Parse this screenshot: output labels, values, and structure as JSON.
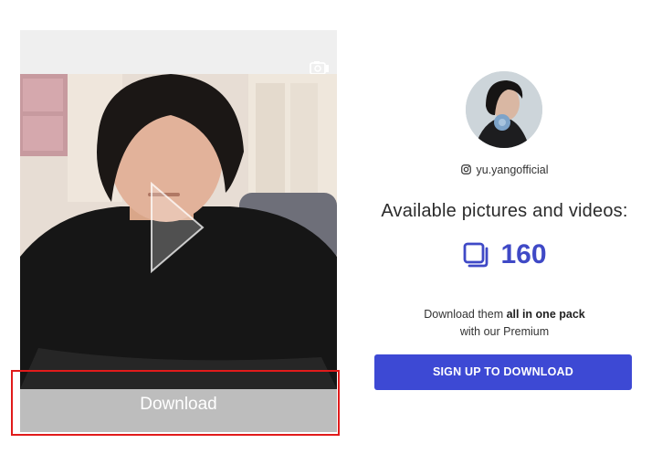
{
  "media": {
    "download_label": "Download",
    "camera_icon": "camera-icon",
    "play_icon": "play-icon"
  },
  "profile": {
    "handle": "yu.yangofficial",
    "handle_icon": "instagram-icon",
    "avatar": "avatar"
  },
  "stats": {
    "title": "Available pictures and videos:",
    "count": "160",
    "count_icon": "gallery-icon"
  },
  "premium": {
    "line1_prefix": "Download them ",
    "line1_bold": "all in one pack",
    "line2": "with our Premium"
  },
  "cta": {
    "label": "SIGN UP TO DOWNLOAD"
  },
  "colors": {
    "accent": "#3d49d4",
    "count_color": "#3f49c6",
    "download_bar": "#bdbdbd",
    "highlight": "#e11b1b"
  }
}
